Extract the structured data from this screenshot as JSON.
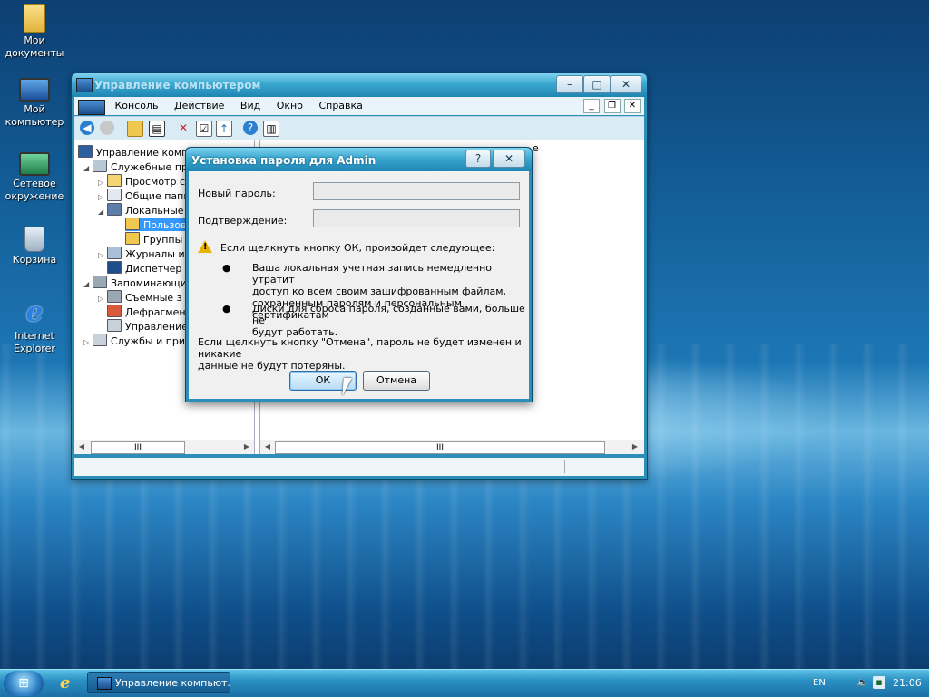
{
  "desktop": {
    "icons": [
      {
        "line1": "Мои",
        "line2": "документы",
        "icon": "folder-icon"
      },
      {
        "line1": "Мой",
        "line2": "компьютер",
        "icon": "computer-icon"
      },
      {
        "line1": "Сетевое",
        "line2": "окружение",
        "icon": "network-icon"
      },
      {
        "line1": "Корзина",
        "line2": "",
        "icon": "recycle-bin-icon"
      },
      {
        "line1": "Internet",
        "line2": "Explorer",
        "icon": "ie-icon"
      }
    ]
  },
  "window": {
    "title": "Управление компьютером",
    "menu": [
      "Консоль",
      "Действие",
      "Вид",
      "Окно",
      "Справка"
    ],
    "tree": [
      {
        "label": "Управление компью",
        "indent": 0
      },
      {
        "label": "Служебные про",
        "indent": 1
      },
      {
        "label": "Просмотр с",
        "indent": 2
      },
      {
        "label": "Общие папк",
        "indent": 2
      },
      {
        "label": "Локальные",
        "indent": 2
      },
      {
        "label": "Пользов",
        "indent": 3
      },
      {
        "label": "Группы",
        "indent": 3
      },
      {
        "label": "Журналы и",
        "indent": 2
      },
      {
        "label": "Диспетчер",
        "indent": 2
      },
      {
        "label": "Запоминающие",
        "indent": 1
      },
      {
        "label": "Съемные з",
        "indent": 2
      },
      {
        "label": "Дефрагмен",
        "indent": 2
      },
      {
        "label": "Управление",
        "indent": 2
      },
      {
        "label": "Службы и прило",
        "indent": 1
      }
    ],
    "list_header": "е",
    "list_rows": [
      "ная учетная запись адм",
      "used for running the ASP",
      "запись для предоставл",
      "ная запись поставщика",
      "ная учетная запись для"
    ],
    "scroll_thumb": "III"
  },
  "dialog": {
    "title": "Установка пароля для Admin",
    "help_label": "?",
    "close_label": "✕",
    "new_password_label": "Новый пароль:",
    "confirm_label": "Подтверждение:",
    "new_password_value": "",
    "confirm_value": "",
    "warning": "Если щелкнуть кнопку ОК, произойдет следующее:",
    "bullet1_line1": "Ваша локальная учетная запись немедленно утратит",
    "bullet1_line2": "доступ ко всем своим зашифрованным файлам,",
    "bullet1_line3": "сохраненным паролям и персональным сертификатам",
    "bullet2_line1": "Диски для сброса пароля, созданные вами, больше не",
    "bullet2_line2": "будут работать.",
    "cancel_note_line1": "Если щелкнуть кнопку \"Отмена\", пароль не будет изменен и никакие",
    "cancel_note_line2": "данные не будут потеряны.",
    "ok_label": "ОК",
    "cancel_label": "Отмена"
  },
  "taskbar": {
    "task_label": "Управление компьют...",
    "language": "EN",
    "clock": "21:06"
  }
}
